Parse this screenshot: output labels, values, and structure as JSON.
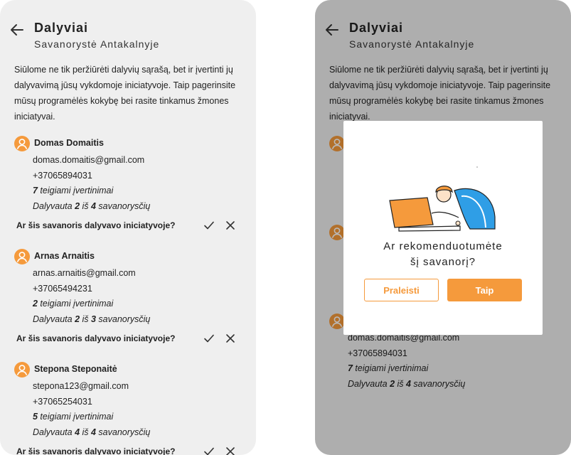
{
  "header": {
    "title": "Dalyviai",
    "subtitle": "Savanorystė Antakalnyje"
  },
  "intro": "Siūlome ne tik peržiūrėti dalyvių sąrašą, bet ir įvertinti jų dalyvavimą jūsų vykdomoje iniciatyvoje. Taip pagerinsite mūsų programėlės kokybę bei rasite tinkamus žmones iniciatyvai.",
  "question": "Ar šis savanoris dalyvavo iniciatyvoje?",
  "participants": [
    {
      "name": "Domas Domaitis",
      "email": "domas.domaitis@gmail.com",
      "phone": "+37065894031",
      "ratings_count": "7",
      "ratings_text": " teigiami įvertinimai",
      "participated_prefix": "Dalyvauta ",
      "participated_done": "2",
      "participated_mid": " iš ",
      "participated_total": "4",
      "participated_suffix": " savanorysčių"
    },
    {
      "name": "Arnas Arnaitis",
      "email": "arnas.arnaitis@gmail.com",
      "phone": "+37065494231",
      "ratings_count": "2",
      "ratings_text": " teigiami įvertinimai",
      "participated_prefix": "Dalyvauta ",
      "participated_done": "2",
      "participated_mid": " iš ",
      "participated_total": "3",
      "participated_suffix": " savanorysčių"
    },
    {
      "name": "Stepona Steponaitė",
      "email": "stepona123@gmail.com",
      "phone": "+37065254031",
      "ratings_count": "5",
      "ratings_text": " teigiami įvertinimai",
      "participated_prefix": "Dalyvauta ",
      "participated_done": "4",
      "participated_mid": " iš ",
      "participated_total": "4",
      "participated_suffix": " savanorysčių"
    }
  ],
  "modal": {
    "question_line1": "Ar rekomenduotumėte",
    "question_line2": "šį savanorį?",
    "skip_label": "Praleisti",
    "yes_label": "Taip"
  },
  "icons": {
    "back": "arrow-back-icon",
    "avatar": "person-icon",
    "confirm": "check-icon",
    "reject": "close-icon"
  },
  "colors": {
    "accent": "#f59a3c",
    "screen_bg": "#efefef",
    "overlay": "rgba(0,0,0,0.27)"
  }
}
